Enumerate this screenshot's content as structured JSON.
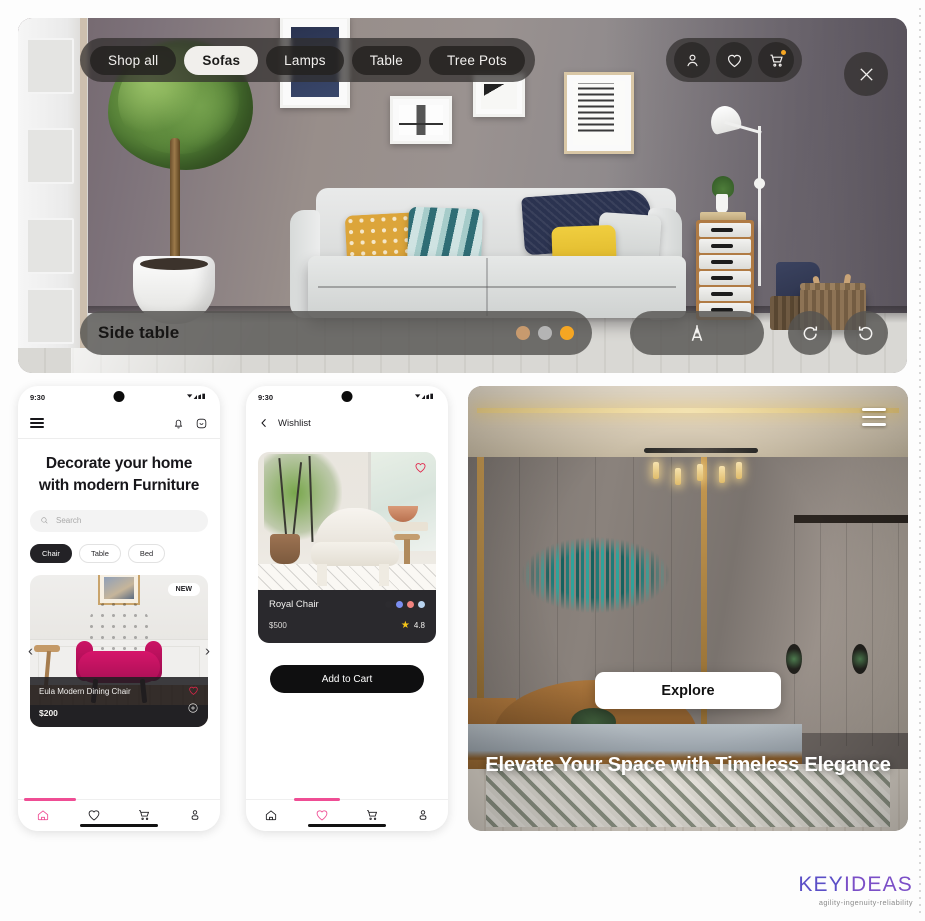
{
  "hero": {
    "categories": [
      {
        "label": "Shop all",
        "active": false
      },
      {
        "label": "Sofas",
        "active": true
      },
      {
        "label": "Lamps",
        "active": false
      },
      {
        "label": "Table",
        "active": false
      },
      {
        "label": "Tree Pots",
        "active": false
      }
    ],
    "icons": [
      {
        "name": "account-icon"
      },
      {
        "name": "wishlist-heart-icon"
      },
      {
        "name": "cart-icon"
      }
    ],
    "close_label": "close-icon",
    "selected_item_label": "Side table",
    "swatches": [
      {
        "name": "tan",
        "color": "#c79a6e"
      },
      {
        "name": "grey",
        "color": "#b4b4b4"
      },
      {
        "name": "orange",
        "color": "#f5a623"
      }
    ],
    "active_swatch_index": 2,
    "tool_label": "measure-tool-icon",
    "redo_label": "redo-icon",
    "undo_label": "undo-icon"
  },
  "phone_home": {
    "status": {
      "time": "9:30"
    },
    "menu_label": "hamburger-menu-icon",
    "top_icons": [
      {
        "name": "notification-bell-icon"
      },
      {
        "name": "smiley-face-icon"
      }
    ],
    "headline_line1": "Decorate your home",
    "headline_line2": "with modern Furniture",
    "search": {
      "placeholder": "Search",
      "value": ""
    },
    "categories": [
      {
        "label": "Chair",
        "active": true
      },
      {
        "label": "Table",
        "active": false
      },
      {
        "label": "Bed",
        "active": false
      }
    ],
    "product": {
      "badge": "NEW",
      "title": "Eula Modern Dining Chair",
      "price": "$200"
    },
    "carousel": {
      "prev": "‹",
      "next": "›"
    },
    "bottom_nav": [
      {
        "name": "home-icon",
        "active": true
      },
      {
        "name": "heart-icon",
        "active": false
      },
      {
        "name": "cart-icon",
        "active": false
      },
      {
        "name": "profile-icon",
        "active": false
      }
    ]
  },
  "phone_wishlist": {
    "status": {
      "time": "9:30"
    },
    "back_label": "back-chevron-icon",
    "title": "Wishlist",
    "product": {
      "name": "Royal Chair",
      "price": "$500",
      "rating": "4.8",
      "colors": [
        {
          "name": "black",
          "color": "#2c2b2f"
        },
        {
          "name": "blue",
          "color": "#7b8ef0"
        },
        {
          "name": "salmon",
          "color": "#f0837f"
        },
        {
          "name": "light-blue",
          "color": "#b9d4ef"
        }
      ]
    },
    "add_to_cart": "Add to Cart",
    "bottom_nav": [
      {
        "name": "home-icon",
        "active": false
      },
      {
        "name": "heart-icon",
        "active": true
      },
      {
        "name": "cart-icon",
        "active": false
      },
      {
        "name": "profile-icon",
        "active": false
      }
    ]
  },
  "bedroom_panel": {
    "menu_label": "hamburger-menu-icon",
    "explore_button": "Explore",
    "caption": "Elevate Your Space with Timeless Elegance"
  },
  "logo": {
    "part1": "KEY",
    "part2": "IDEAS",
    "tagline": "agility-ingenuity-reliability",
    "color1": "#5b4fc7",
    "color2": "#7b4fc7"
  }
}
